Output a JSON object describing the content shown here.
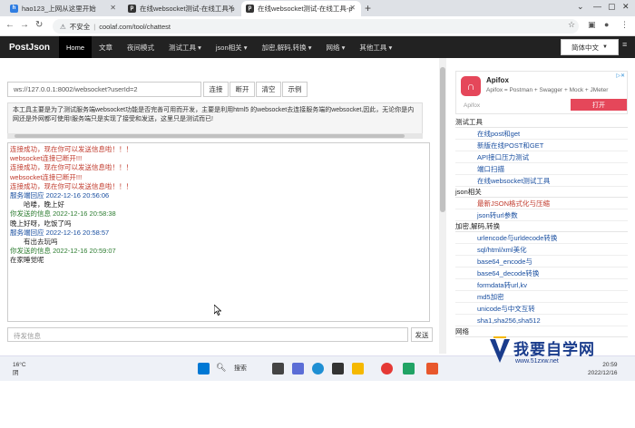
{
  "browser": {
    "tabs": [
      {
        "label": "hao123_上网从这里开始",
        "favicon": "hao123"
      },
      {
        "label": "在线websocket测试-在线工具-p",
        "favicon": "pj"
      },
      {
        "label": "在线websocket测试-在线工具-p",
        "favicon": "pj"
      }
    ],
    "new_tab": "+",
    "security_text": "不安全",
    "url": "coolaf.com/tool/chattest"
  },
  "site": {
    "brand": "PostJson",
    "nav": [
      "Home",
      "文章",
      "夜间模式",
      "测试工具 ▾",
      "json相关 ▾",
      "加密,解码,转换 ▾",
      "网络 ▾",
      "其他工具 ▾"
    ],
    "language": "简体中文"
  },
  "ws": {
    "url_value": "ws://127.0.0.1:8002/websocket?userId=2",
    "buttons": [
      "连接",
      "断开",
      "清空",
      "示例"
    ],
    "description": "本工具主要是为了测试服务端websocket功能是否完善可用而开发，主要是利用html5 的websocket去连接服务端的websocket,因此，无论你是内网还是外网都可使用!服务端只是实现了接受和发送，这里只是测试而已!",
    "log": [
      {
        "text": "连接成功，现在你可以发送信息啦！！！",
        "color": "red"
      },
      {
        "text": "websocket连接已断开!!!",
        "color": "red"
      },
      {
        "text": "连接成功，现在你可以发送信息啦！！！",
        "color": "red"
      },
      {
        "text": "websocket连接已断开!!!",
        "color": "red"
      },
      {
        "text": "连接成功，现在你可以发送信息啦！！！",
        "color": "red"
      },
      {
        "text": "服务端回应 2022-12-16 20:56:06",
        "color": "blue"
      },
      {
        "text": "　　哈喽，晚上好",
        "color": "black"
      },
      {
        "text": "你发送的信息 2022-12-16 20:58:38",
        "color": "green"
      },
      {
        "text": "晚上好呀，吃饭了吗",
        "color": "black"
      },
      {
        "text": "服务端回应 2022-12-16 20:58:57",
        "color": "blue"
      },
      {
        "text": "　　有出去玩吗",
        "color": "black"
      },
      {
        "text": "你发送的信息 2022-12-16 20:59:07",
        "color": "green"
      },
      {
        "text": "在家睡觉呢",
        "color": "black"
      }
    ],
    "send_placeholder": "待发信息",
    "send_button": "发送"
  },
  "ad": {
    "title": "Apifox",
    "subtitle": "Apifox = Postman + Swagger + Mock + JMeter",
    "brand": "Apifox",
    "button": "打开"
  },
  "sidebar": [
    {
      "heading": "测试工具",
      "links": [
        {
          "label": "在线post和get",
          "highlight": false
        },
        {
          "label": "新版在线POST和GET",
          "highlight": false
        },
        {
          "label": "API接口压力测试",
          "highlight": false
        },
        {
          "label": "端口扫描",
          "highlight": false
        },
        {
          "label": "在线websocket测试工具",
          "highlight": false
        }
      ]
    },
    {
      "heading": "json相关",
      "links": [
        {
          "label": "最新JSON格式化与压缩",
          "highlight": true
        },
        {
          "label": "json转url参数",
          "highlight": false
        }
      ]
    },
    {
      "heading": "加密,解码,转换",
      "links": [
        {
          "label": "urlencode与urldecode转换",
          "highlight": false
        },
        {
          "label": "sql/html/xml美化",
          "highlight": false
        },
        {
          "label": "base64_encode与",
          "highlight": false
        },
        {
          "label": "base64_decode转换",
          "highlight": false
        },
        {
          "label": "formdata转url,kv",
          "highlight": false
        },
        {
          "label": "md5加密",
          "highlight": false
        },
        {
          "label": "unicode与中文互转",
          "highlight": false
        },
        {
          "label": "sha1,sha256,sha512",
          "highlight": false
        }
      ]
    },
    {
      "heading": "网络",
      "links": []
    }
  ],
  "taskbar": {
    "weather_temp": "16°C",
    "weather_desc": "阴",
    "search": "搜索",
    "time": "20:59",
    "date": "2022/12/16"
  },
  "watermark": {
    "text": "我要自学网",
    "url": "www.51zxw.net"
  }
}
